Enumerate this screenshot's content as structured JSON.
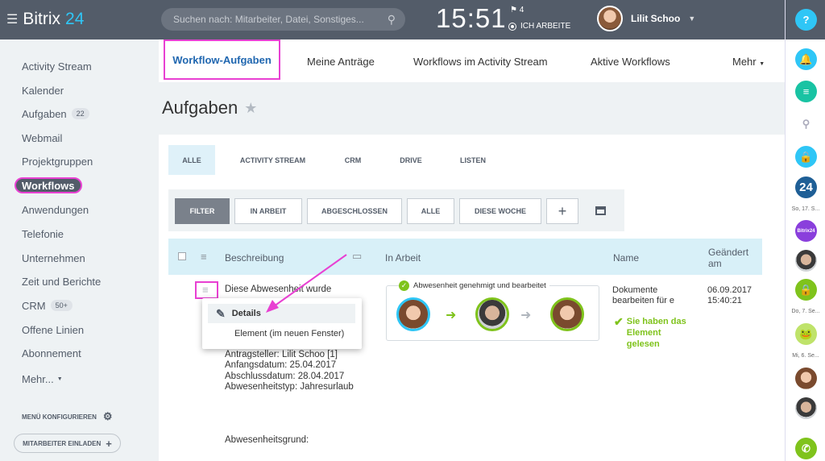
{
  "header": {
    "logo_main": "Bitrix",
    "logo_num": "24",
    "search_placeholder": "Suchen nach: Mitarbeiter, Datei, Sonstiges...",
    "clock": "15:51",
    "flag_count": "4",
    "work_status": "ICH ARBEITE",
    "user_name": "Lilit Schoo"
  },
  "sidebar": {
    "items": [
      {
        "label": "Activity Stream"
      },
      {
        "label": "Kalender"
      },
      {
        "label": "Aufgaben",
        "badge": "22"
      },
      {
        "label": "Webmail"
      },
      {
        "label": "Projektgruppen"
      },
      {
        "label": "Workflows"
      },
      {
        "label": "Anwendungen"
      },
      {
        "label": "Telefonie"
      },
      {
        "label": "Unternehmen"
      },
      {
        "label": "Zeit und Berichte"
      },
      {
        "label": "CRM",
        "badge": "50+"
      },
      {
        "label": "Offene Linien"
      },
      {
        "label": "Abonnement"
      },
      {
        "label": "Mehr..."
      }
    ],
    "configure": "MENÜ KONFIGURIEREN",
    "invite": "MITARBEITER EINLADEN"
  },
  "tabs": [
    "Workflow-Aufgaben",
    "Meine Anträge",
    "Workflows im Activity Stream",
    "Aktive Workflows",
    "Mehr"
  ],
  "page_title": "Aufgaben",
  "filter_tabs": [
    "ALLE",
    "ACTIVITY STREAM",
    "CRM",
    "DRIVE",
    "LISTEN"
  ],
  "filter_buttons": [
    "FILTER",
    "IN ARBEIT",
    "ABGESCHLOSSEN",
    "ALLE",
    "DIESE WOCHE"
  ],
  "table": {
    "headers": [
      "Beschreibung",
      "In Arbeit",
      "Name",
      "Geändert am"
    ],
    "row": {
      "desc_first": "Diese Abwesenheit wurde",
      "desc_lines": "Antragsteller: Lilit Schoo [1] Anfangsdatum: 25.04.2017 Abschlussdatum: 28.04.2017 Abwesenheitstyp: Jahresurlaub",
      "desc_reason": "Abwesenheitsgrund:",
      "workflow_title": "Abwesenheit genehmigt und bearbeitet",
      "name": "Dokumente bearbeiten für e",
      "read_status": "Sie haben das Element gelesen",
      "date": "06.09.2017",
      "time": "15:40:21"
    }
  },
  "context_menu": {
    "details": "Details",
    "new_window": "Element (im neuen Fenster)"
  },
  "rightbar": {
    "captions": [
      "So, 17. S...",
      "Do, 7. Se...",
      "Mi, 6. Se..."
    ],
    "help": "?",
    "b24": "24",
    "tile": "Bitrix24"
  },
  "colors": {
    "accent": "#2fc6f6",
    "highlight": "#e840d2",
    "green": "#7fc31c",
    "header": "#535c69"
  }
}
